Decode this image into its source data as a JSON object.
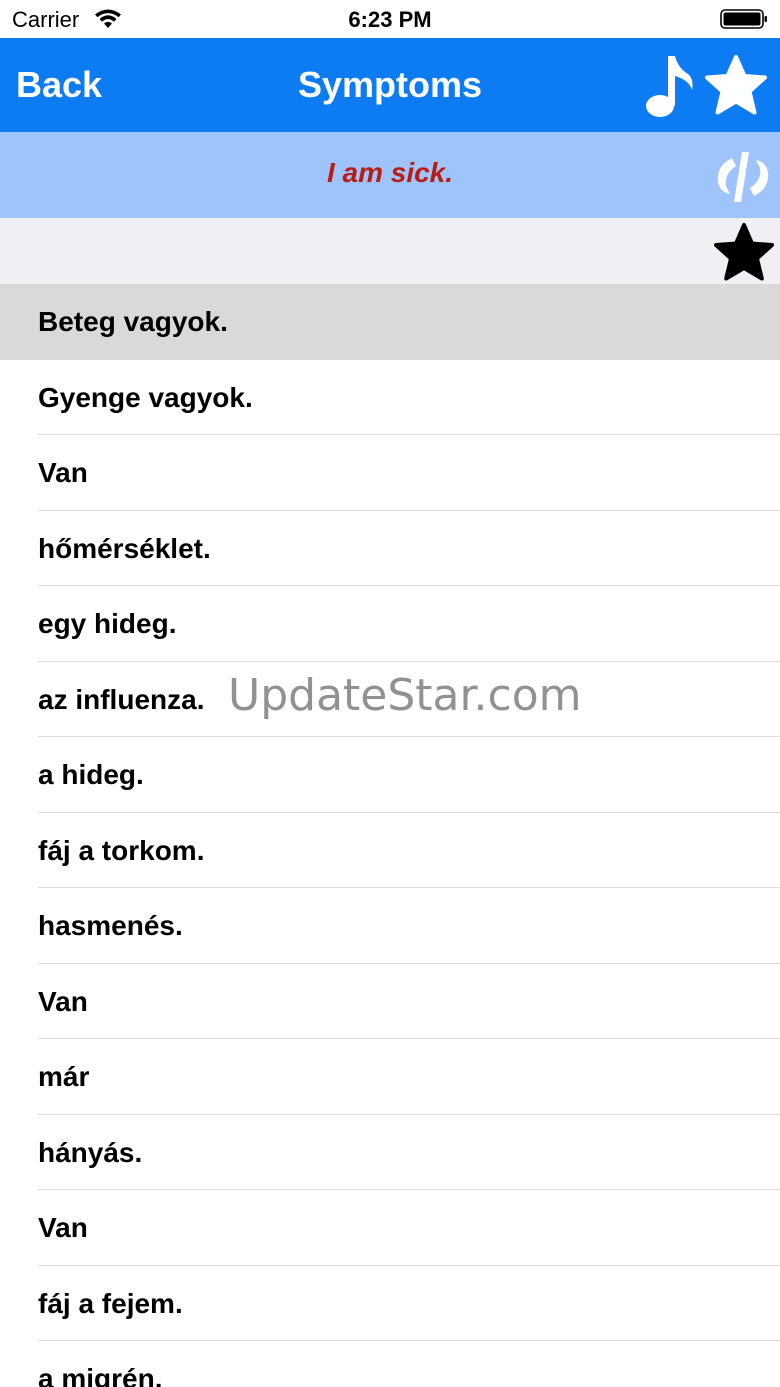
{
  "status_bar": {
    "carrier": "Carrier",
    "time": "6:23 PM",
    "icons": [
      "wifi-icon",
      "battery-icon"
    ]
  },
  "nav": {
    "back_label": "Back",
    "title": "Symptoms",
    "icons": [
      "music-note-icon",
      "star-icon"
    ],
    "color": "#0d7cf2"
  },
  "translation": {
    "text": "I am sick.",
    "text_color": "#b81c12",
    "background": "#9fc3fb",
    "icon": "swap-icon"
  },
  "favorites_bar": {
    "icon": "star-icon"
  },
  "phrases": {
    "selected_index": 0,
    "items": [
      "Beteg vagyok.",
      "Gyenge vagyok.",
      "Van",
      "hőmérséklet.",
      "egy hideg.",
      "az influenza.",
      "a hideg.",
      "fáj a torkom.",
      "hasmenés.",
      "Van",
      "már",
      "hányás.",
      "Van",
      "fáj a fejem.",
      "a migrén."
    ]
  },
  "watermark": {
    "text": "UpdateStar.com"
  }
}
